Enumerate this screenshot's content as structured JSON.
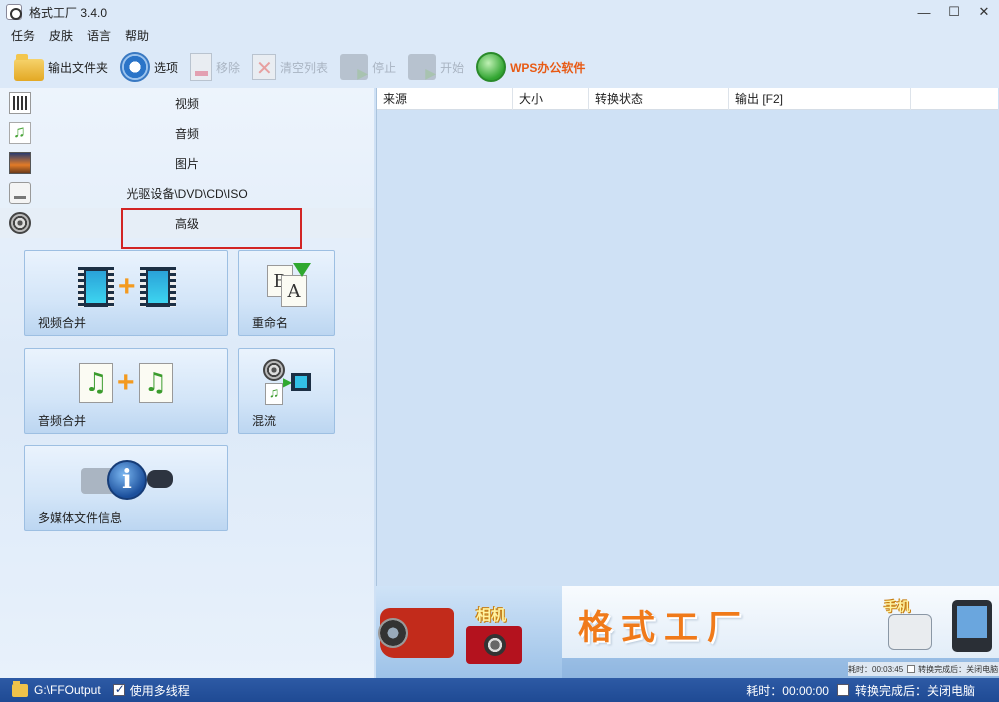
{
  "window": {
    "title": "格式工厂 3.4.0",
    "controls": [
      "—",
      "☐",
      "✕"
    ]
  },
  "menu": [
    "任务",
    "皮肤",
    "语言",
    "帮助"
  ],
  "toolbar": {
    "output_folder": "输出文件夹",
    "options": "选项",
    "remove": "移除",
    "clear_list": "清空列表",
    "stop": "停止",
    "start": "开始",
    "wps": "WPS办公软件"
  },
  "categories": {
    "video": "视频",
    "audio": "音频",
    "image": "图片",
    "disc": "光驱设备\\DVD\\CD\\ISO",
    "advanced": "高级"
  },
  "tiles": {
    "video_merge": "视频合并",
    "rename": "重命名",
    "audio_merge": "音频合并",
    "mux": "混流",
    "media_info": "多媒体文件信息",
    "plus_sign": "+",
    "music_glyph": "♫",
    "info_glyph": "i",
    "rename_a": "A",
    "rename_b": "B"
  },
  "list_columns": [
    "来源",
    "大小",
    "转换状态",
    "输出 [F2]"
  ],
  "banner": {
    "camera_label": "相机",
    "brand": "格式工厂",
    "phone_label": "手机",
    "mini_status_time": "耗时：00:03:45",
    "mini_status_after": "转换完成后：关闭电脑"
  },
  "statusbar": {
    "output_path": "G:\\FFOutput",
    "multithread_label": "使用多线程",
    "multithread_checked": true,
    "elapsed": "耗时：00:00:00",
    "after_convert": "转换完成后：关闭电脑",
    "after_convert_checked": false
  }
}
